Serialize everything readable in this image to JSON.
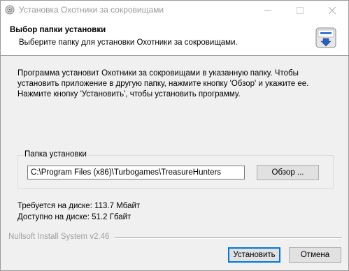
{
  "window": {
    "title": "Установка Охотники за сокровищами"
  },
  "header": {
    "title": "Выбор папки установки",
    "subtitle": "Выберите папку для установки Охотники за сокровищами.",
    "logo_icon": "nsis-installer-logo-icon"
  },
  "main": {
    "description": "Программа установит Охотники за сокровищами в указанную папку. Чтобы установить приложение в другую папку, нажмите кнопку 'Обзор' и укажите ее. Нажмите кнопку 'Установить', чтобы установить программу.",
    "folder_group_label": "Папка установки",
    "folder_path": "C:\\Program Files (x86)\\Turbogames\\TreasureHunters",
    "browse_label": "Обзор ...",
    "space_required": "Требуется на диске: 113.7 Мбайт",
    "space_available": "Доступно на диске: 51.2 Гбайт"
  },
  "footer": {
    "branding": "Nullsoft Install System v2.46",
    "install_label": "Установить",
    "cancel_label": "Отмена"
  },
  "colors": {
    "accent": "#0078d7",
    "window_bg": "#f0f0f0",
    "header_bg": "#ffffff",
    "disabled_text": "#a0a0a0"
  }
}
